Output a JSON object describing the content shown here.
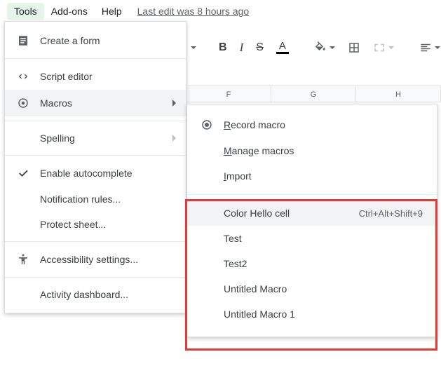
{
  "menubar": {
    "tools": "Tools",
    "addons": "Add-ons",
    "help": "Help",
    "last_edit": "Last edit was 8 hours ago"
  },
  "toolbar": {
    "bold": "B",
    "italic": "I",
    "strike": "S",
    "textcolor": "A"
  },
  "columns": [
    "F",
    "G",
    "H"
  ],
  "tools_menu": {
    "create_form": "Create a form",
    "script_editor": "Script editor",
    "macros": "Macros",
    "spelling": "Spelling",
    "enable_autocomplete": "Enable autocomplete",
    "notification_rules": "Notification rules...",
    "protect_sheet": "Protect sheet...",
    "accessibility": "Accessibility settings...",
    "activity_dashboard": "Activity dashboard..."
  },
  "macros_submenu": {
    "record": "Record macro",
    "manage": "Manage macros",
    "import": "Import",
    "user_macros": [
      {
        "label": "Color Hello cell",
        "shortcut": "Ctrl+Alt+Shift+9"
      },
      {
        "label": "Test",
        "shortcut": ""
      },
      {
        "label": "Test2",
        "shortcut": ""
      },
      {
        "label": "Untitled Macro",
        "shortcut": ""
      },
      {
        "label": "Untitled Macro 1",
        "shortcut": ""
      }
    ]
  }
}
